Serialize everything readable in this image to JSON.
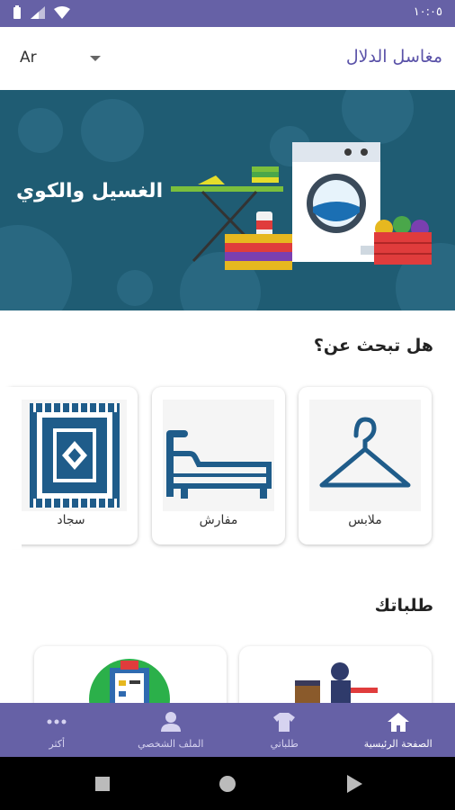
{
  "status_bar": {
    "time": "١٠:٠٥"
  },
  "app_bar": {
    "title": "مغاسل الدلال",
    "language": "Ar"
  },
  "banner": {
    "text": "الغسيل والكوي"
  },
  "search_section": {
    "title": "هل تبحث عن؟",
    "categories": [
      {
        "label": "ملابس",
        "icon": "hanger-icon"
      },
      {
        "label": "مفارش",
        "icon": "bed-icon"
      },
      {
        "label": "سجاد",
        "icon": "rug-icon"
      }
    ]
  },
  "orders_section": {
    "title": "طلباتك"
  },
  "bottom_nav": {
    "items": [
      {
        "label": "الصفحة الرئيسية",
        "icon": "home-icon",
        "active": true
      },
      {
        "label": "طلباتي",
        "icon": "shirt-icon",
        "active": false
      },
      {
        "label": "الملف الشخصي",
        "icon": "person-icon",
        "active": false
      },
      {
        "label": "أكثر",
        "icon": "more-icon",
        "active": false
      }
    ]
  },
  "colors": {
    "primary": "#6661a6",
    "title": "#5a52a8",
    "banner_bg": "#1f5c73",
    "icon_blue": "#1f5c8a"
  }
}
